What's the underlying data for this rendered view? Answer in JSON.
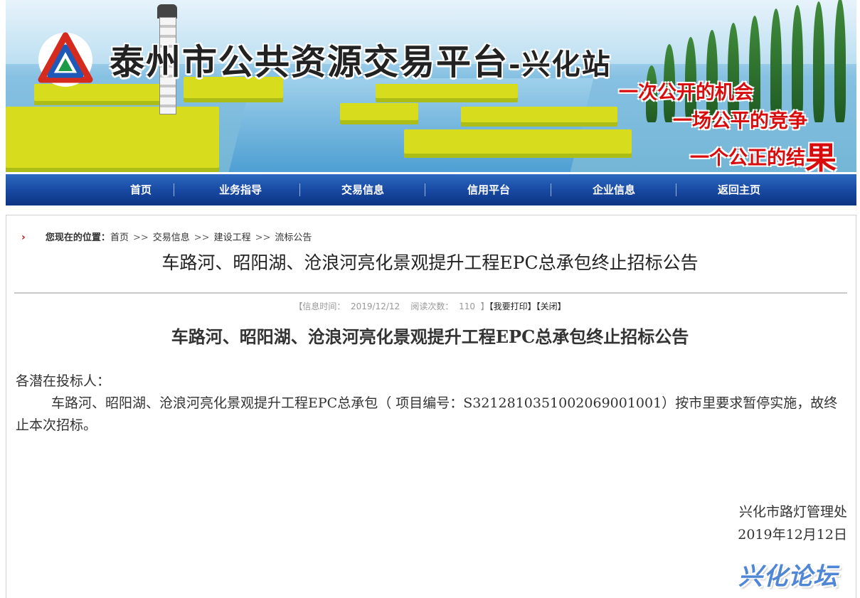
{
  "banner": {
    "site_title": "泰州市公共资源交易平台",
    "site_suffix": "-兴化站",
    "slogans": [
      "一次公开的机会",
      "一场公平的竞争",
      "一个公正的结",
      "果"
    ],
    "logo_icon": "triangle-logo-icon"
  },
  "nav": {
    "items": [
      "首页",
      "业务指导",
      "交易信息",
      "信用平台",
      "企业信息",
      "返回主页"
    ]
  },
  "breadcrumb": {
    "label": "您现在的位置：",
    "items": [
      "首页",
      "交易信息",
      "建设工程",
      "流标公告"
    ],
    "separator": ">>"
  },
  "page": {
    "title": "车路河、昭阳湖、沧浪河亮化景观提升工程EPC总承包终止招标公告"
  },
  "meta": {
    "prefix": "【信息时间：",
    "date": "2019/12/12",
    "reads_label": "阅读次数：",
    "reads": "110",
    "suffix": "】",
    "print": "【我要打印】",
    "close": "【关闭】"
  },
  "article": {
    "title": "车路河、昭阳湖、沧浪河亮化景观提升工程EPC总承包终止招标公告",
    "salutation": "各潜在投标人：",
    "paragraph": "车路河、昭阳湖、沧浪河亮化景观提升工程EPC总承包（ 项目编号：S3212810351002069001001）按市里要求暂停实施，故终止本次招标。",
    "signature_org": "兴化市路灯管理处",
    "signature_date": "2019年12月12日"
  },
  "watermark": "兴化论坛",
  "colors": {
    "nav_blue": "#1747a0",
    "slogan_red": "#d80c0c",
    "breadcrumb_arrow": "#c61313"
  }
}
